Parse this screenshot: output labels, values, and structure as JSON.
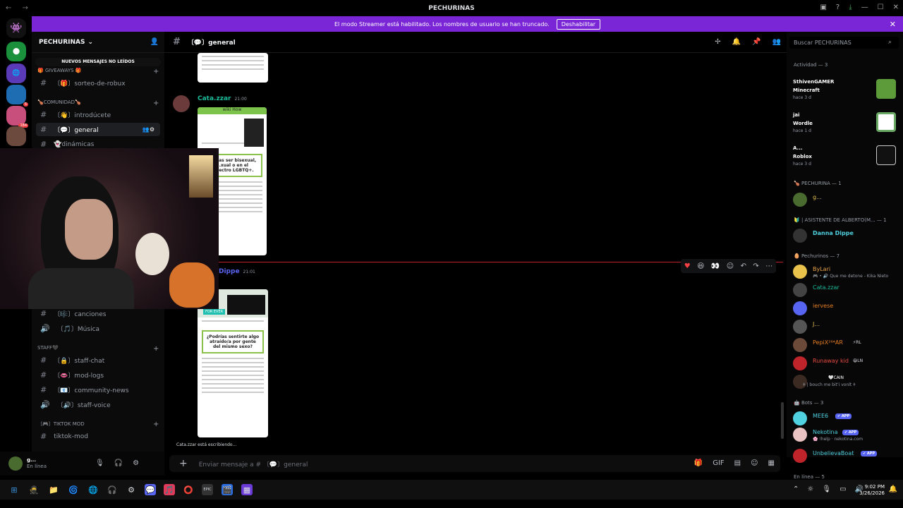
{
  "window": {
    "title": "PECHURINAS",
    "nav": "← →"
  },
  "banner": {
    "text": "El modo Streamer está habilitado. Los nombres de usuario se han truncado.",
    "button": "Deshabilitar"
  },
  "servers": {
    "badges": [
      "5",
      "184"
    ]
  },
  "sidebar": {
    "server_name": "PECHURINAS",
    "unread_label": "NUEVOS MENSAJES NO LEÍDOS",
    "categories": [
      {
        "label": "🎁 GIVEAWAYS 🎁"
      },
      {
        "label": "🍗COMUNIDAD🍗"
      },
      {
        "label": "STAFF🖤"
      },
      {
        "label": "〔🎮〕TIKTOK MOD"
      }
    ],
    "channels": [
      {
        "label": "〔🎁〕sorteo-de-robux"
      },
      {
        "label": "〔👋〕introdúcete"
      },
      {
        "label": "〔💬〕general"
      },
      {
        "label": "👻dinámicas"
      },
      {
        "label": "〔🎼〕canciones"
      },
      {
        "label": "〔🎵〕Música"
      },
      {
        "label": "〔🔒〕staff-chat"
      },
      {
        "label": "〔👄〕mod-logs"
      },
      {
        "label": "〔📧〕community-news"
      },
      {
        "label": "〔🔊〕staff-voice"
      },
      {
        "label": "tiktok-mod"
      }
    ]
  },
  "user": {
    "name": "g...",
    "status": "En línea"
  },
  "channel": {
    "name": "〔💬〕general"
  },
  "messages": [
    {
      "author": "Cata.zzar",
      "time": "21:00",
      "color": "#1abc9c"
    },
    {
      "author": "Dippe",
      "time": "21:01",
      "color": "#5865f2"
    }
  ],
  "images": {
    "img1": {
      "header": "wiki How",
      "box": "...mías ser bisexual, ...xual o en el espectro LGBTQ+."
    },
    "img2": {
      "tag": "FOR EVER",
      "box": "¿Podrías sentirte algo atraído/a por gente del mismo sexo?"
    }
  },
  "typing": "Cata.zzar está escribiendo...",
  "composer": {
    "placeholder": "Enviar mensaje a # 〔💬〕general"
  },
  "search": {
    "placeholder": "Buscar PECHURINAS"
  },
  "members": {
    "activity_title": "Actividad — 3",
    "activities": [
      {
        "name": "SthivenGAMER",
        "game": "Minecraft",
        "ago": "hace 3 d"
      },
      {
        "name": "jai",
        "game": "Wordle",
        "ago": "hace 1 d"
      },
      {
        "name": "A...",
        "game": "Roblox",
        "ago": "hace 3 d"
      }
    ],
    "groups": [
      {
        "title": "🍗 PECHURINA — 1",
        "members": [
          {
            "name": "g...",
            "color": "#e6c24a"
          }
        ]
      },
      {
        "title": "🔰 | ASISTENTE DE ALBERTO(M... — 1",
        "members": [
          {
            "name": "Danna Dippe",
            "color": "#4fd1e0"
          }
        ]
      },
      {
        "title": "🥚 Pechurinos — 7",
        "members": [
          {
            "name": "ByLari",
            "color": "#e8a24a",
            "sub": "🎮 • 🔊 Que me detone - Kika Nieto"
          },
          {
            "name": "Cata.zzar",
            "color": "#1abc9c",
            "sub": ""
          },
          {
            "name": "iervese",
            "color": "#e67e22",
            "sub": ""
          },
          {
            "name": "J...",
            "color": "#e6c24a",
            "sub": ""
          },
          {
            "name": "PepiX²⁶⁴AR",
            "color": "#e67e22",
            "sub": "",
            "tag": "⚡RL"
          },
          {
            "name": "Runaway kid",
            "color": "#e74c3c",
            "sub": "",
            "tag": "😆LN"
          },
          {
            "name": "",
            "color": "#bbb",
            "sub": "🕇 | bouch me bit'i vonlt 🕇",
            "tag": "🤍CAIN"
          }
        ]
      },
      {
        "title": "🤖 Bots — 3",
        "members": [
          {
            "name": "MEE6",
            "color": "#4fd1e0",
            "sub": "",
            "app": "✔ APP"
          },
          {
            "name": "Nekotina",
            "color": "#4fd1e0",
            "sub": "🌸 !help · nekotina.com",
            "app": "✔ APP"
          },
          {
            "name": "UnbelievaBoat",
            "color": "#4fd1e0",
            "sub": "",
            "app": "✔ APP"
          }
        ]
      }
    ],
    "online_title": "En línea — 5"
  },
  "taskbar": {
    "time": "9:02 PM",
    "date": "3/26/2026",
    "apps": [
      "⊞",
      "🥷",
      "📁",
      "🌀",
      "🌐",
      "🎧",
      "⚙",
      "💬",
      "🎵",
      "⭕",
      "EPIC",
      "🎬",
      "▦"
    ]
  },
  "colors": {
    "banner": "#7a26d6",
    "accent": "#5865f2",
    "new_line": "#c0242b"
  }
}
